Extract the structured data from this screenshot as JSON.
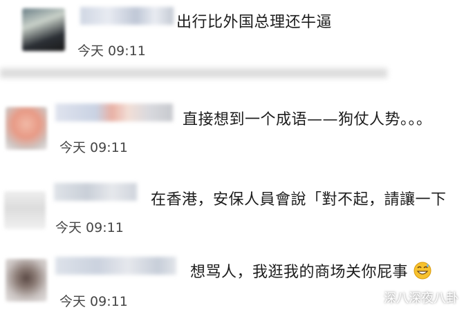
{
  "comments": [
    {
      "text": "出行比外国总理还牛逼",
      "time": "今天 09:11"
    },
    {
      "text": "直接想到一个成语——狗仗人势。。。",
      "time": "今天 09:11"
    },
    {
      "text": "在香港，安保人員會說「對不起，請讓一下",
      "time": "今天 09:11"
    },
    {
      "text": "想骂人，我逛我的商场关你屁事",
      "time": "今天 09:11"
    }
  ],
  "watermark": {
    "label": "深八深夜八卦"
  },
  "emoji": {
    "name": "grinning-sweat-face-icon"
  }
}
